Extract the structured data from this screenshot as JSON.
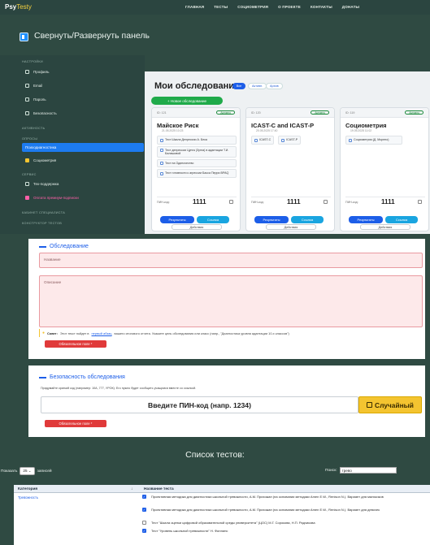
{
  "nav": {
    "brand": "Psy",
    "brand_accent": "Testy",
    "links": [
      "ГЛАВНАЯ",
      "ТЕСТЫ",
      "СОЦИОМЕТРИЯ",
      "О ПРОЕКТЕ",
      "КОНТАКТЫ",
      "ДОНАТЫ"
    ]
  },
  "panel_toggle_label": "Свернуть/Развернуть панель",
  "sidebar": {
    "h_settings": "НАСТРОЙКИ",
    "profile": "Профиль",
    "email": "Email",
    "password": "Пароль",
    "security": "Безопасность",
    "h_activity": "АКТИВНОСТЬ",
    "h_surveys": "ОПРОСЫ",
    "surveys_item": "Психодиагностика",
    "sociometry": "Социометрия",
    "h_service": "СЕРВИС",
    "support": "Тех-поддержка",
    "premium": "Оплата премиум-подписки",
    "h_specialist": "КАБИНЕТ СПЕЦИАЛИСТА",
    "h_constructor": "КОНСТРУКТОР ТЕСТОВ"
  },
  "surveys": {
    "title": "Мои обследования",
    "filters": {
      "all": "Все",
      "active": "Активн.",
      "archive": "Архив"
    },
    "new_button": "+ Новое обследование",
    "cards": [
      {
        "id": "ID: 121",
        "status": "Активно",
        "name": "Майское Риск",
        "date": "21.05.2025 10:23",
        "tests": [
          "Тест Шкала Депрессии А. Бека",
          "Тест депрессии Цунга (Зунга) в адаптации Т.И. Балашовой",
          "Тест на Одиночество",
          "Тест готовности к агрессии Басса Перри BPAQ"
        ],
        "pin_label": "ПИН-код:",
        "pin": "1111",
        "results": "Результаты",
        "link": "Ссылка",
        "actions": "Действия"
      },
      {
        "id": "ID: 120",
        "status": "Активно",
        "name": "ICAST-C and ICAST-P",
        "date": "20.05.2025 17:40",
        "tests": [
          "ICAST-C",
          "ICAST-P"
        ],
        "pin_label": "ПИН-код:",
        "pin": "1111",
        "results": "Результаты",
        "link": "Ссылка",
        "actions": "Действия"
      },
      {
        "id": "ID: 119",
        "status": "Активно",
        "name": "Социометрия",
        "date": "19.05.2025 11:02",
        "tests": [
          "Социометрия (Д. Морено)"
        ],
        "pin_label": "ПИН-код:",
        "pin": "1111",
        "results": "Результаты",
        "link": "Ссылка",
        "actions": "Действия"
      }
    ]
  },
  "form": {
    "section_title": "Обследование",
    "name_placeholder": "Название",
    "desc_placeholder": "Описание",
    "tip_prefix": "Совет:",
    "tip_text_1": "Этот текст пойдет в",
    "tip_link": "первый абзац",
    "tip_text_2": "вашего итогового отчета. Укажите цель обследования или класс (напр., \"Диагностика уровня адаптации 10-х классов\")",
    "required": "Обязательное поле *"
  },
  "security": {
    "title": "Безопасность обследования",
    "desc": "Придумайте краткий код (например: 10А, 777, УРОК). Его нужно будет сообщить учащимся вместе со ссылкой.",
    "pin_placeholder": "Введите ПИН-код (напр. 1234)",
    "random_button": "Случайный",
    "required": "Обязательное поле *"
  },
  "tests": {
    "title": "Список тестов:",
    "show": "Показать",
    "page_size": "25",
    "entries": "записей",
    "search_label": "Поиск:",
    "search_value": "трево",
    "col_category": "Категория",
    "col_name": "Название теста",
    "rows": [
      {
        "category": "Тревожность",
        "checked": true,
        "name": "Проективная методика для диагностики школьной тревожности, А.М. Прихожан (на основании методики Amen E.W., Renison N.). Вариант для мальчиков"
      },
      {
        "category": "",
        "checked": true,
        "name": "Проективная методика для диагностики школьной тревожности, А.М. Прихожан (на основании методики Amen E.W., Renison N.). Вариант для девочек"
      },
      {
        "category": "",
        "checked": false,
        "name": "Тест \"Шкала оценки цифровой образовательной среды университета\" (ЦОС) М.Г. Сорокова, Н.П. Радчикова"
      },
      {
        "category": "",
        "checked": true,
        "name": "Тест \"Уровень школьной тревожности\" Н. Филлипс"
      }
    ]
  }
}
